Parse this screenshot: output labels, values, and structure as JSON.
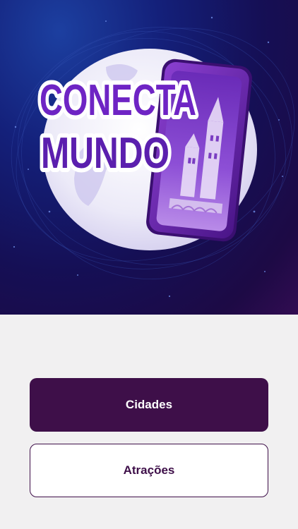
{
  "app": {
    "logo_line1": "CONECTA",
    "logo_line2": "MUNDO"
  },
  "buttons": {
    "primary_label": "Cidades",
    "secondary_label": "Atrações"
  },
  "colors": {
    "accent": "#3e0f49",
    "background": "#f1f0f1",
    "hero_dark": "#150f55",
    "logo_purple": "#7b2ec8"
  }
}
